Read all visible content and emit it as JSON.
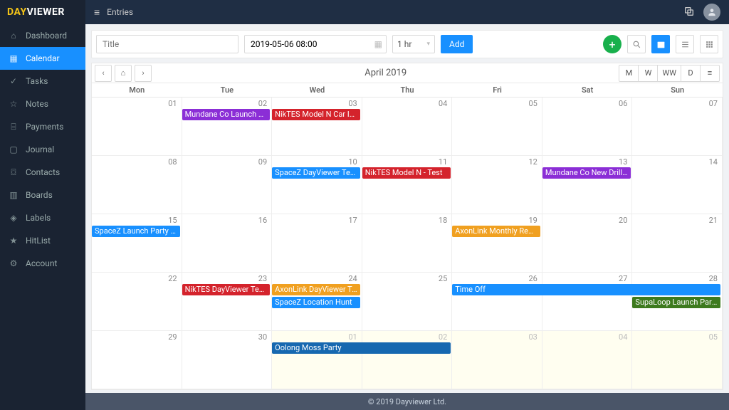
{
  "brand": {
    "day": "DAY",
    "viewer": "VIEWER"
  },
  "topbar": {
    "section": "Entries"
  },
  "nav": {
    "items": [
      {
        "label": "Dashboard",
        "icon": "⌂"
      },
      {
        "label": "Calendar",
        "icon": "▦",
        "active": true
      },
      {
        "label": "Tasks",
        "icon": "✓"
      },
      {
        "label": "Notes",
        "icon": "☆"
      },
      {
        "label": "Payments",
        "icon": "⌸"
      },
      {
        "label": "Journal",
        "icon": "▢"
      },
      {
        "label": "Contacts",
        "icon": "⌼"
      },
      {
        "label": "Boards",
        "icon": "▥"
      },
      {
        "label": "Labels",
        "icon": "◈"
      },
      {
        "label": "HitList",
        "icon": "★"
      },
      {
        "label": "Account",
        "icon": "⚙"
      }
    ]
  },
  "toolbar": {
    "title_placeholder": "Title",
    "datetime_value": "2019-05-06 08:00",
    "duration": "1 hr",
    "add": "Add"
  },
  "calendar": {
    "title": "April 2019",
    "views": [
      "M",
      "W",
      "WW",
      "D",
      "≡"
    ],
    "dayHeaders": [
      "Mon",
      "Tue",
      "Wed",
      "Thu",
      "Fri",
      "Sat",
      "Sun"
    ],
    "cells": [
      [
        {
          "n": "01"
        },
        {
          "n": "02"
        },
        {
          "n": "03"
        },
        {
          "n": "04"
        },
        {
          "n": "05"
        },
        {
          "n": "06"
        },
        {
          "n": "07"
        }
      ],
      [
        {
          "n": "08"
        },
        {
          "n": "09"
        },
        {
          "n": "10"
        },
        {
          "n": "11"
        },
        {
          "n": "12"
        },
        {
          "n": "13"
        },
        {
          "n": "14"
        }
      ],
      [
        {
          "n": "15"
        },
        {
          "n": "16"
        },
        {
          "n": "17"
        },
        {
          "n": "18"
        },
        {
          "n": "19"
        },
        {
          "n": "20"
        },
        {
          "n": "21"
        }
      ],
      [
        {
          "n": "22"
        },
        {
          "n": "23"
        },
        {
          "n": "24"
        },
        {
          "n": "25"
        },
        {
          "n": "26"
        },
        {
          "n": "27"
        },
        {
          "n": "28"
        }
      ],
      [
        {
          "n": "29"
        },
        {
          "n": "30"
        },
        {
          "n": "01",
          "dim": true
        },
        {
          "n": "02",
          "dim": true
        },
        {
          "n": "03",
          "dim": true
        },
        {
          "n": "04",
          "dim": true
        },
        {
          "n": "05",
          "dim": true
        }
      ]
    ],
    "events": [
      {
        "label": "Mundane Co Launch Party ...",
        "color": "#8b2ed6",
        "row": 0,
        "col": 1,
        "span": 1,
        "slot": 0
      },
      {
        "label": "NikTES Model N Car Ideas",
        "color": "#d4232c",
        "row": 0,
        "col": 2,
        "span": 1,
        "slot": 0
      },
      {
        "label": "SpaceZ DayViewer Team Ro...",
        "color": "#1890ff",
        "row": 1,
        "col": 2,
        "span": 1,
        "slot": 0
      },
      {
        "label": "NikTES Model N - Test",
        "color": "#d4232c",
        "row": 1,
        "col": 3,
        "span": 1,
        "slot": 0
      },
      {
        "label": "Mundane Co New Drill Bit",
        "color": "#8b2ed6",
        "row": 1,
        "col": 5,
        "span": 1,
        "slot": 0
      },
      {
        "label": "SpaceZ Launch Party Paym...",
        "color": "#1890ff",
        "row": 2,
        "col": 0,
        "span": 1,
        "slot": 0
      },
      {
        "label": "AxonLink Monthly Report",
        "color": "#f0a020",
        "row": 2,
        "col": 4,
        "span": 1,
        "slot": 0
      },
      {
        "label": "NikTES DayViewer Team Room",
        "color": "#d4232c",
        "row": 3,
        "col": 1,
        "span": 1,
        "slot": 0
      },
      {
        "label": "AxonLink DayViewer Team ...",
        "color": "#f0a020",
        "row": 3,
        "col": 2,
        "span": 1,
        "slot": 0
      },
      {
        "label": "SpaceZ Location Hunt",
        "color": "#1890ff",
        "row": 3,
        "col": 2,
        "span": 1,
        "slot": 1
      },
      {
        "label": "Time Off",
        "color": "#1890ff",
        "row": 3,
        "col": 4,
        "span": 3,
        "slot": 0
      },
      {
        "label": "SupaLoop Launch Party Pa...",
        "color": "#3d7a1e",
        "row": 3,
        "col": 6,
        "span": 1,
        "slot": 1
      },
      {
        "label": "Oolong Moss Party",
        "color": "#1668b0",
        "row": 4,
        "col": 2,
        "span": 2,
        "slot": 0
      }
    ]
  },
  "footer": "© 2019 Dayviewer Ltd."
}
